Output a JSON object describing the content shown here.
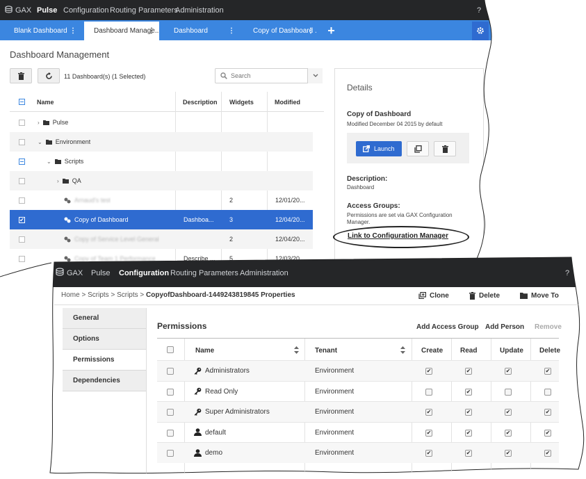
{
  "pulse": {
    "nav": {
      "brand": "GAX",
      "items": [
        "Pulse",
        "Configuration",
        "Routing Parameters",
        "Administration"
      ],
      "help": "?"
    },
    "tabs": [
      {
        "label": "Blank Dashboard"
      },
      {
        "label": "Dashboard Manage.."
      },
      {
        "label": "Dashboard"
      },
      {
        "label": "Copy of Dashboard ."
      }
    ],
    "tab_dots": "⋮",
    "add_tab": "+",
    "page_title": "Dashboard Management",
    "count_text": "11 Dashboard(s) (1 Selected)",
    "search_placeholder": "Search",
    "columns": {
      "name": "Name",
      "description": "Description",
      "widgets": "Widgets",
      "modified": "Modified"
    },
    "rows": [
      {
        "name": "Pulse",
        "description": "",
        "widgets": "",
        "modified": ""
      },
      {
        "name": "Environment",
        "description": "",
        "widgets": "",
        "modified": ""
      },
      {
        "name": "Scripts",
        "description": "",
        "widgets": "",
        "modified": ""
      },
      {
        "name": "QA",
        "description": "",
        "widgets": "",
        "modified": ""
      },
      {
        "name": "Arnaud's test",
        "description": "",
        "widgets": "2",
        "modified": "12/01/20..."
      },
      {
        "name": "Copy of Dashboard",
        "description": "Dashboa...",
        "widgets": "3",
        "modified": "12/04/20..."
      },
      {
        "name": "Copy of Service Level General",
        "description": "",
        "widgets": "2",
        "modified": "12/04/20..."
      },
      {
        "name": "Copy of Team 1 Performance",
        "description": "Describe ...",
        "widgets": "5",
        "modified": "12/03/20..."
      }
    ],
    "details": {
      "title": "Details",
      "name": "Copy of Dashboard",
      "modified": "Modified December 04 2015 by default",
      "launch": "Launch",
      "description_label": "Description:",
      "description_value": "Dashboard",
      "access_label": "Access Groups:",
      "access_value": "Permissions are set via GAX Configuration Manager.",
      "link": "Link to Configuration Manager"
    }
  },
  "config": {
    "nav": {
      "brand": "GAX",
      "items": [
        "Pulse",
        "Configuration",
        "Routing Parameters",
        "Administration"
      ],
      "help": "?"
    },
    "breadcrumb": {
      "home": "Home",
      "sep": ">",
      "scripts1": "Scripts",
      "scripts2": "Scripts",
      "current": "CopyofDashboard-1449243819845 Properties"
    },
    "actions": {
      "clone": "Clone",
      "delete": "Delete",
      "move": "Move To"
    },
    "sidebar": [
      "General",
      "Options",
      "Permissions",
      "Dependencies"
    ],
    "section_title": "Permissions",
    "section_actions": {
      "add_group": "Add Access Group",
      "add_person": "Add Person",
      "remove": "Remove"
    },
    "columns": {
      "name": "Name",
      "tenant": "Tenant",
      "create": "Create",
      "read": "Read",
      "update": "Update",
      "delete": "Delete"
    },
    "rows": [
      {
        "name": "Administrators",
        "type": "group",
        "tenant": "Environment",
        "create": true,
        "read": true,
        "update": true,
        "delete": true
      },
      {
        "name": "Read Only",
        "type": "group",
        "tenant": "Environment",
        "create": false,
        "read": true,
        "update": false,
        "delete": false
      },
      {
        "name": "Super Administrators",
        "type": "group",
        "tenant": "Environment",
        "create": true,
        "read": true,
        "update": true,
        "delete": true
      },
      {
        "name": "default",
        "type": "person",
        "tenant": "Environment",
        "create": true,
        "read": true,
        "update": true,
        "delete": true
      },
      {
        "name": "demo",
        "type": "person",
        "tenant": "Environment",
        "create": true,
        "read": true,
        "update": true,
        "delete": true
      }
    ],
    "check_glyph": "✔"
  }
}
